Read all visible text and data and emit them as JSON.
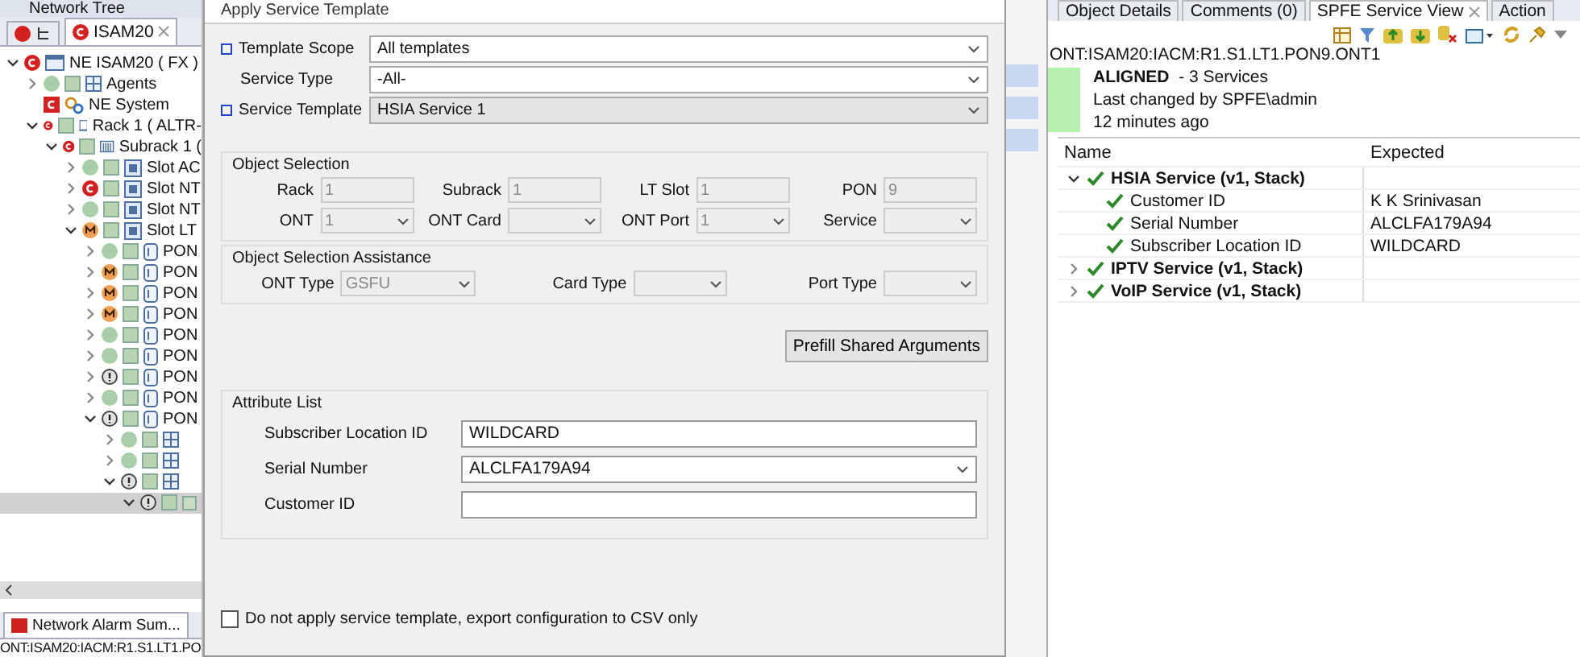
{
  "left_panel": {
    "title": "Network Tree",
    "tab": {
      "label": "ISAM20",
      "selected": true
    },
    "tree": [
      {
        "label": "NE ISAM20 ( FX )",
        "color": "#d61f1f",
        "kind": "ne",
        "expanded": true,
        "selected": false,
        "children": [
          {
            "label": "Agents",
            "color": "#a8cfa8",
            "kind": "grid",
            "expanded": false,
            "selected": false
          },
          {
            "label": "NE System",
            "color": "#d61f1f",
            "kind": "system",
            "selected": false
          },
          {
            "label": "Rack 1 ( ALTR-",
            "color": "#d61f1f",
            "kind": "rack",
            "expanded": true,
            "selected": false,
            "children": [
              {
                "label": "Subrack 1 (",
                "color": "#d61f1f",
                "kind": "subrack",
                "expanded": true,
                "selected": false,
                "children": [
                  {
                    "label": "Slot AC",
                    "color": "#a8cfa8",
                    "kind": "slot",
                    "expanded": false,
                    "selected": false
                  },
                  {
                    "label": "Slot NT",
                    "color": "#d61f1f",
                    "kind": "slot",
                    "expanded": false,
                    "selected": false
                  },
                  {
                    "label": "Slot NT",
                    "color": "#a8cfa8",
                    "kind": "slot",
                    "expanded": false,
                    "selected": false
                  },
                  {
                    "label": "Slot LT",
                    "color": "#f0a050",
                    "kind": "slot",
                    "expanded": true,
                    "selected": false,
                    "children": [
                      {
                        "label": "PON",
                        "color": "#a8cfa8",
                        "kind": "port",
                        "expanded": false,
                        "selected": false
                      },
                      {
                        "label": "PON",
                        "color": "#f0a050",
                        "kind": "port",
                        "expanded": false,
                        "selected": false
                      },
                      {
                        "label": "PON",
                        "color": "#f0a050",
                        "kind": "port",
                        "expanded": false,
                        "selected": false
                      },
                      {
                        "label": "PON",
                        "color": "#f0a050",
                        "kind": "port",
                        "expanded": false,
                        "selected": false
                      },
                      {
                        "label": "PON",
                        "color": "#a8cfa8",
                        "kind": "port",
                        "expanded": false,
                        "selected": false
                      },
                      {
                        "label": "PON",
                        "color": "#a8cfa8",
                        "kind": "port",
                        "expanded": false,
                        "selected": false
                      },
                      {
                        "label": "PON",
                        "color": "#e2e2e2",
                        "kind": "port",
                        "expanded": false,
                        "selected": false
                      },
                      {
                        "label": "PON",
                        "color": "#a8cfa8",
                        "kind": "port",
                        "expanded": false,
                        "selected": false
                      },
                      {
                        "label": "PON",
                        "color": "#e2e2e2",
                        "kind": "port",
                        "expanded": true,
                        "selected": false,
                        "children": [
                          {
                            "color": "#a8cfa8",
                            "kind": "grid",
                            "expanded": false,
                            "selected": false
                          },
                          {
                            "color": "#a8cfa8",
                            "kind": "grid",
                            "expanded": false,
                            "selected": false
                          },
                          {
                            "color": "#e2e2e2",
                            "kind": "grid",
                            "expanded": true,
                            "selected": false,
                            "children": [
                              {
                                "color": "#e2e2e2",
                                "kind": "square",
                                "expanded": true,
                                "selected": true
                              }
                            ]
                          }
                        ]
                      }
                    ]
                  }
                ]
              }
            ]
          }
        ]
      }
    ],
    "alarm_tab": {
      "label": "Network Alarm Sum..."
    },
    "status_text": "ONT:ISAM20:IACM:R1.S1.LT1.PO"
  },
  "dialog": {
    "title": "Apply Service Template",
    "top_fields": [
      {
        "label": "Template Scope",
        "value": "All templates",
        "required": true,
        "disabled": false
      },
      {
        "label": "Service Type",
        "value": "-All-",
        "required": false,
        "disabled": false
      },
      {
        "label": "Service Template",
        "value": "HSIA Service 1",
        "required": true,
        "disabled": true
      }
    ],
    "object_selection": {
      "title": "Object Selection",
      "fields": [
        {
          "label": "Rack",
          "value": "1",
          "kind": "text",
          "disabled": true
        },
        {
          "label": "Subrack",
          "value": "1",
          "kind": "text",
          "disabled": true
        },
        {
          "label": "LT Slot",
          "value": "1",
          "kind": "text",
          "disabled": true
        },
        {
          "label": "PON",
          "value": "9",
          "kind": "text",
          "disabled": true
        },
        {
          "label": "ONT",
          "value": "1",
          "kind": "combo",
          "disabled": true
        },
        {
          "label": "ONT Card",
          "kind": "combo",
          "disabled": true
        },
        {
          "label": "ONT Port",
          "value": "1",
          "kind": "combo",
          "disabled": true
        },
        {
          "label": "Service",
          "kind": "combo",
          "disabled": true
        }
      ]
    },
    "assistance": {
      "title": "Object Selection Assistance",
      "fields": [
        {
          "label": "ONT Type",
          "value": "GSFU",
          "kind": "combo",
          "disabled": true
        },
        {
          "label": "Card Type",
          "kind": "combo",
          "disabled": true
        },
        {
          "label": "Port Type",
          "kind": "combo",
          "disabled": true
        }
      ]
    },
    "prefill_button": "Prefill Shared Arguments",
    "attributes": {
      "title": "Attribute List",
      "fields": [
        {
          "label": "Subscriber Location ID",
          "value": "WILDCARD",
          "kind": "text"
        },
        {
          "label": "Serial Number",
          "value": "ALCLFA179A94",
          "kind": "combo"
        },
        {
          "label": "Customer ID",
          "kind": "text"
        }
      ]
    },
    "export_checkbox": {
      "label": "Do not apply service template, export configuration to CSV only",
      "checked": false
    }
  },
  "right_panel": {
    "tabs": [
      {
        "label": "Object Details",
        "selected": false
      },
      {
        "label": "Comments (0)",
        "selected": false
      },
      {
        "label": "SPFE Service View",
        "selected": true
      },
      {
        "label": "Action",
        "selected": false
      }
    ],
    "path": "ONT:ISAM20:IACM:R1.S1.LT1.PON9.ONT1",
    "status": {
      "state": "ALIGNED",
      "count": "- 3 Services",
      "changed_by": "Last changed by SPFE\\admin",
      "time": "12 minutes ago",
      "color": "#b8f0b0"
    },
    "table": {
      "columns": [
        "Name",
        "Expected"
      ],
      "rows": [
        {
          "name": "HSIA Service (v1, Stack)",
          "expanded": true,
          "children": [
            {
              "name": "Customer ID",
              "expected": "K K Srinivasan"
            },
            {
              "name": "Serial Number",
              "expected": "ALCLFA179A94"
            },
            {
              "name": "Subscriber Location ID",
              "expected": "WILDCARD"
            }
          ]
        },
        {
          "name": "IPTV Service (v1, Stack)",
          "expanded": false
        },
        {
          "name": "VoIP Service (v1, Stack)",
          "expanded": false
        }
      ]
    }
  }
}
